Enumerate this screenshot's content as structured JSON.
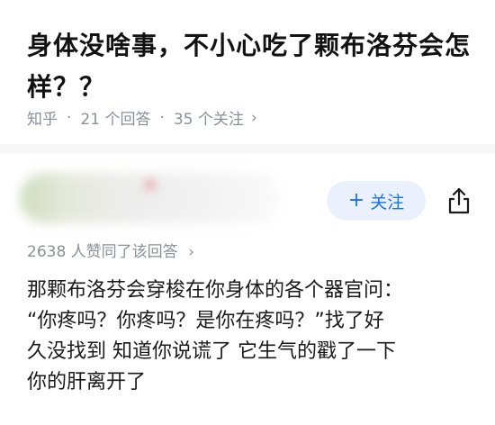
{
  "question": {
    "title": "身体没啥事，不小心吃了颗布洛芬会怎样？？",
    "source": "知乎",
    "answers_count": "21 个回答",
    "followers_count": "35 个关注",
    "separator": "·",
    "chevron": "›"
  },
  "author": {
    "follow_plus": "+",
    "follow_label": "关注",
    "share_icon": "share-icon"
  },
  "answer": {
    "votes_text": "2638 人赞同了该回答",
    "chevron": "›",
    "lines": [
      "那颗布洛芬会穿梭在你身体的各个器官问：",
      "“你疼吗？你疼吗？是你在疼吗？”找了好",
      "久没找到 知道你说谎了 它生气的戳了一下",
      "你的肝离开了"
    ]
  },
  "colors": {
    "accent": "#1772f6",
    "follow_bg": "#eaf1fd",
    "meta_text": "#8a8f99",
    "title_text": "#121212"
  }
}
